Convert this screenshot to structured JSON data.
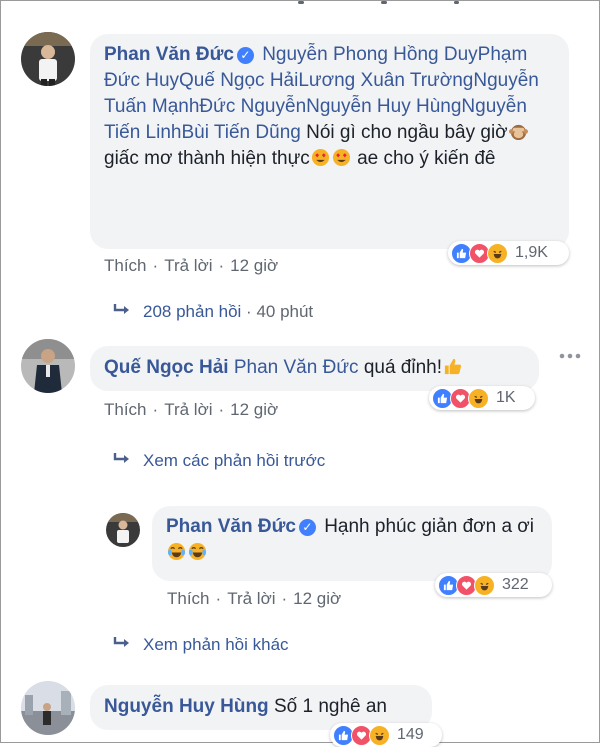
{
  "comments": [
    {
      "author": "Phan Văn Đức",
      "verified": true,
      "tags": [
        "Nguyễn Phong Hồng Duy",
        "Phạm Đức Huy",
        "Quế Ngọc Hải",
        "Lương Xuân Trường",
        "Nguyễn Tuấn Mạnh",
        "Đức Nguyễn",
        "Nguyễn Huy Hùng",
        "Nguyễn Tiến Linh",
        "Bùi Tiến Dũng"
      ],
      "text_1": "Nói gì cho ngầu bây giờ",
      "text_2": "giấc mơ thành hiện thực",
      "text_3": "ae cho ý kiến đê",
      "like_label": "Thích",
      "reply_label": "Trả lời",
      "time": "12 giờ",
      "reaction_count": "1,9K",
      "replies_label": "208 phản hồi",
      "replies_time": "40 phút"
    },
    {
      "author": "Quế Ngọc Hải",
      "tag": "Phan Văn Đức",
      "text": "quá đỉnh!",
      "like_label": "Thích",
      "reply_label": "Trả lời",
      "time": "12 giờ",
      "reaction_count": "1K",
      "view_previous": "Xem các phản hồi trước",
      "more_icon": "more-dots-icon"
    },
    {
      "author": "Phan Văn Đức",
      "verified": true,
      "text": "Hạnh phúc giản đơn a ơi",
      "like_label": "Thích",
      "reply_label": "Trả lời",
      "time": "12 giờ",
      "reaction_count": "322",
      "view_other": "Xem phản hồi khác"
    },
    {
      "author": "Nguyễn Huy Hùng",
      "text": "Số 1 nghê an",
      "reaction_count": "149"
    }
  ],
  "colors": {
    "link": "#385898",
    "bubble": "#f2f3f5",
    "like": "#4080ff",
    "love": "#f25268",
    "haha": "#f7b125"
  }
}
